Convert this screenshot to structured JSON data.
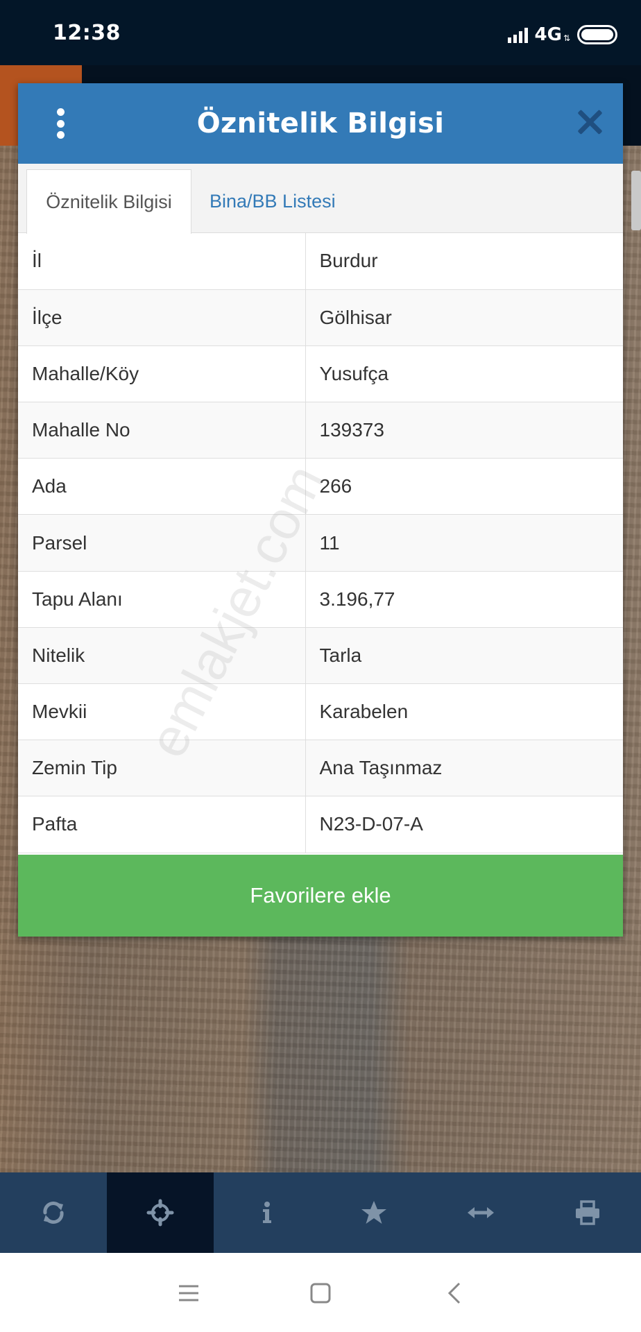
{
  "status": {
    "time": "12:38",
    "network": "4G"
  },
  "modal": {
    "title": "Öznitelik Bilgisi",
    "tabs": [
      {
        "label": "Öznitelik Bilgisi",
        "active": true
      },
      {
        "label": "Bina/BB Listesi",
        "active": false
      }
    ],
    "rows": [
      {
        "key": "İl",
        "value": "Burdur"
      },
      {
        "key": "İlçe",
        "value": "Gölhisar"
      },
      {
        "key": "Mahalle/Köy",
        "value": "Yusufça"
      },
      {
        "key": "Mahalle No",
        "value": "139373"
      },
      {
        "key": "Ada",
        "value": "266"
      },
      {
        "key": "Parsel",
        "value": "11"
      },
      {
        "key": "Tapu Alanı",
        "value": "3.196,77"
      },
      {
        "key": "Nitelik",
        "value": "Tarla"
      },
      {
        "key": "Mevkii",
        "value": "Karabelen"
      },
      {
        "key": "Zemin Tip",
        "value": "Ana Taşınmaz"
      },
      {
        "key": "Pafta",
        "value": "N23-D-07-A"
      }
    ],
    "favorite_button": "Favorilere ekle"
  },
  "watermark": "emlakjet.com",
  "toolbar": {
    "items": [
      {
        "icon": "refresh-icon",
        "active": false
      },
      {
        "icon": "crosshair-icon",
        "active": true
      },
      {
        "icon": "info-icon",
        "active": false
      },
      {
        "icon": "star-icon",
        "active": false
      },
      {
        "icon": "measure-arrows-icon",
        "active": false
      },
      {
        "icon": "print-icon",
        "active": false
      }
    ]
  },
  "nav": {
    "icons": [
      "menu-icon",
      "home-icon",
      "back-icon"
    ]
  },
  "colors": {
    "header": "#337ab7",
    "tab_link": "#337ab7",
    "favorite": "#5cb85c",
    "toolbar": "#233f5e",
    "toolbar_active": "#061427",
    "status_bar": "#031628"
  }
}
